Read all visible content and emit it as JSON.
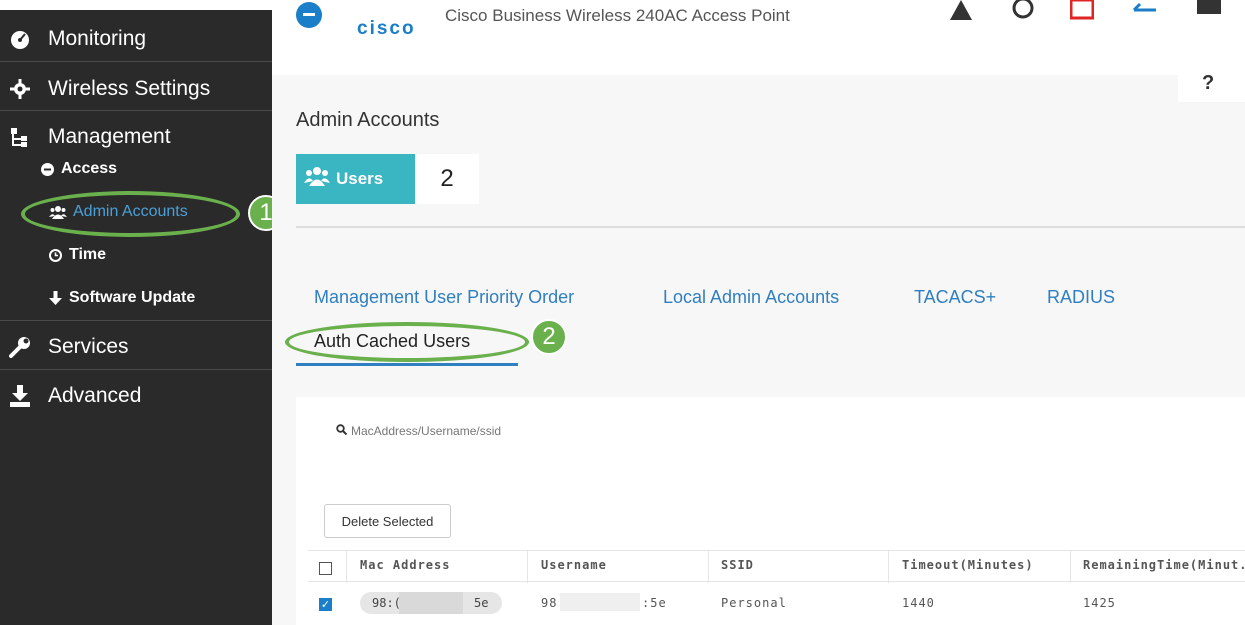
{
  "app": {
    "logo_text": "cisco",
    "title": "Cisco Business Wireless 240AC Access Point",
    "help": "?"
  },
  "sidebar": {
    "items": [
      {
        "label": "Monitoring",
        "icon": "dashboard-icon"
      },
      {
        "label": "Wireless Settings",
        "icon": "gear-icon"
      },
      {
        "label": "Management",
        "icon": "sitemap-icon"
      },
      {
        "label": "Services",
        "icon": "wrench-icon"
      },
      {
        "label": "Advanced",
        "icon": "download-icon"
      }
    ],
    "sub_items": [
      {
        "label": "Access",
        "icon": "minus-circle-icon"
      },
      {
        "label": "Admin Accounts",
        "icon": "users-icon"
      },
      {
        "label": "Time",
        "icon": "clock-icon"
      },
      {
        "label": "Software Update",
        "icon": "arrow-down-icon"
      }
    ]
  },
  "callouts": [
    "1",
    "2"
  ],
  "page": {
    "title": "Admin Accounts",
    "users_label": "Users",
    "users_count": "2"
  },
  "tabs": [
    {
      "label": "Management User Priority Order"
    },
    {
      "label": "Local Admin Accounts"
    },
    {
      "label": "TACACS+"
    },
    {
      "label": "RADIUS"
    },
    {
      "label": "Auth Cached Users",
      "active": true
    }
  ],
  "search": {
    "placeholder": "MacAddress/Username/ssid"
  },
  "delete_button": "Delete Selected",
  "table": {
    "columns": [
      "Mac Address",
      "Username",
      "SSID",
      "Timeout(Minutes)",
      "RemainingTime(Minut..."
    ],
    "rows": [
      {
        "mac_start": "98:(",
        "mac_end": "5e",
        "user_start": "98",
        "user_end": ":5e",
        "ssid": "Personal",
        "timeout": "1440",
        "remaining": "1425",
        "checked": true
      }
    ]
  },
  "colors": {
    "accent": "#3ab5c2",
    "link": "#2f7fc1",
    "callout": "#6ab04c",
    "sidebar": "#2a2a2a"
  }
}
